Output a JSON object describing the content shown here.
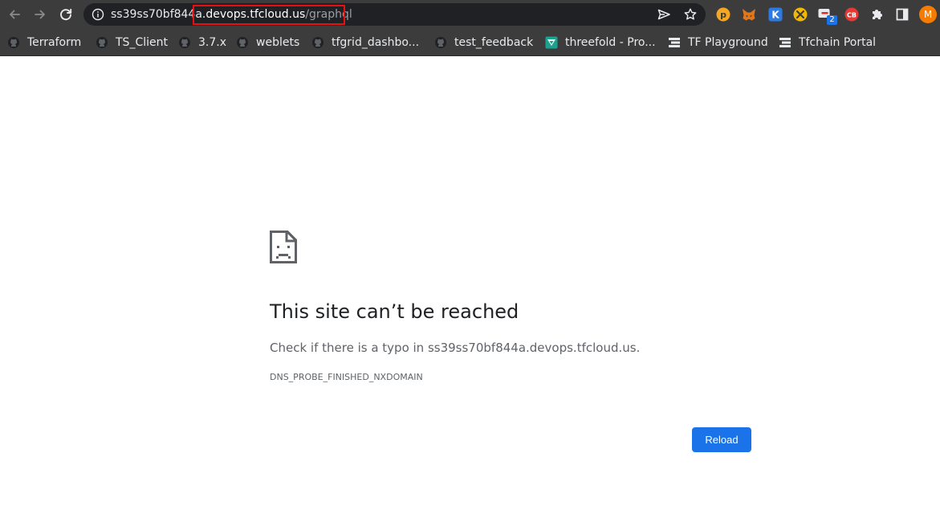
{
  "omnibox": {
    "url_subdomain": "ss39ss70bf844a",
    "url_host": ".devops.tfcloud.us",
    "url_path": "/graphql"
  },
  "bookmarks": [
    {
      "label": "Terraform",
      "icon": "github-icon"
    },
    {
      "label": "TS_Client",
      "icon": "github-icon"
    },
    {
      "label": "3.7.x",
      "icon": "github-icon"
    },
    {
      "label": "weblets",
      "icon": "github-icon"
    },
    {
      "label": "tfgrid_dashbo...",
      "icon": "github-icon"
    },
    {
      "label": "test_feedback",
      "icon": "github-icon"
    },
    {
      "label": "threefold - Pro...",
      "icon": "threefold-icon"
    },
    {
      "label": "TF Playground",
      "icon": "tf-stack-icon"
    },
    {
      "label": "Tfchain Portal",
      "icon": "tf-stack-icon"
    }
  ],
  "extensions": {
    "badge_count": "2"
  },
  "profile": {
    "initial": "M",
    "color": "#f57c00"
  },
  "error": {
    "title": "This site can’t be reached",
    "description": "Check if there is a typo in ss39ss70bf844a.devops.tfcloud.us.",
    "code": "DNS_PROBE_FINISHED_NXDOMAIN",
    "reload_label": "Reload"
  },
  "colors": {
    "accent": "#1a73e8",
    "toolbar_bg": "#3c3c3c",
    "omnibox_bg": "#202124",
    "highlight_box": "#e81010"
  }
}
